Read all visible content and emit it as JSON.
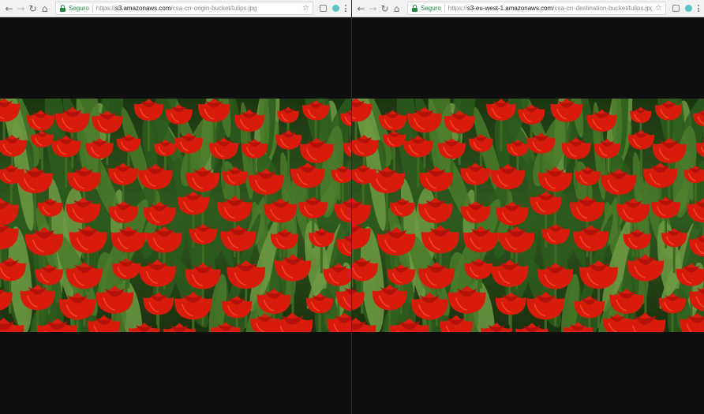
{
  "left_browser": {
    "secure_label": "Seguro",
    "url_scheme": "https://",
    "url_host": "s3.amazonaws.com",
    "url_path": "/csa-crr-origin-bucket/tulips.jpg",
    "image": {
      "subject": "field of red tulips",
      "name": "tulips.jpg"
    }
  },
  "right_browser": {
    "secure_label": "Seguro",
    "url_scheme": "https://",
    "url_host": "s3-eu-west-1.amazonaws.com",
    "url_path": "/csa-crr-destination-bucket/tulips.jpg",
    "image": {
      "subject": "field of red tulips",
      "name": "tulips.jpg"
    }
  },
  "icons": {
    "back": "arrow-left-icon",
    "forward": "arrow-right-icon",
    "reload": "reload-icon",
    "home": "home-icon",
    "lock": "lock-icon",
    "bookmark": "star-icon",
    "extension": "extension-icon",
    "profile": "extension-circle-icon",
    "menu": "kebab-menu-icon"
  },
  "colors": {
    "secure_green": "#1e8e3e",
    "tulip_red": "#d81c0c",
    "leaf_green": "#2c5a1c",
    "page_background": "#0e0e0e"
  }
}
